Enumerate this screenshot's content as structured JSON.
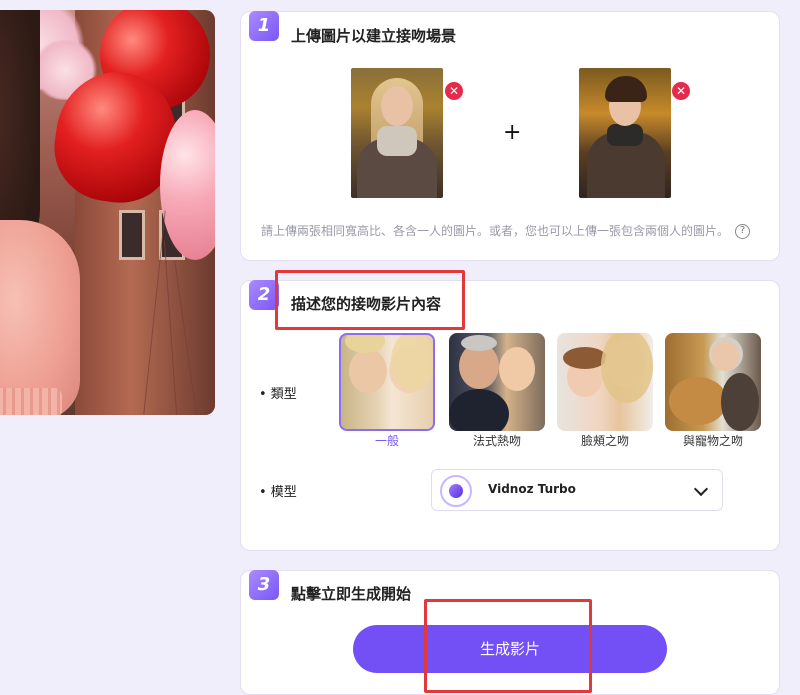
{
  "step1": {
    "number": "1",
    "title": "上傳圖片以建立接吻場景",
    "remove_symbol": "✕",
    "plus_symbol": "+",
    "hint": "請上傳兩張相同寬高比、各含一人的圖片。或者，您也可以上傳一張包含兩個人的圖片。",
    "help_symbol": "?"
  },
  "step2": {
    "number": "2",
    "title": "描述您的接吻影片內容",
    "type_label": "• 類型",
    "model_label": "• 模型",
    "types": [
      {
        "name": "一般",
        "selected": true
      },
      {
        "name": "法式熱吻",
        "selected": false
      },
      {
        "name": "臉頰之吻",
        "selected": false
      },
      {
        "name": "與寵物之吻",
        "selected": false
      }
    ],
    "model": {
      "value": "Vidnoz Turbo"
    }
  },
  "step3": {
    "number": "3",
    "title": "點擊立即生成開始",
    "generate_label": "生成影片"
  },
  "colors": {
    "accent": "#7350f5",
    "highlight_box": "#e0383b",
    "remove": "#e42b4b"
  }
}
